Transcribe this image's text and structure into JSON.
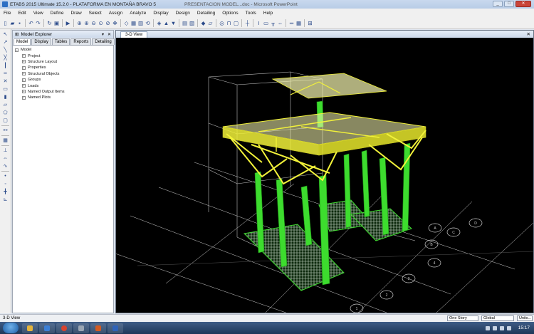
{
  "window": {
    "title": "ETABS 2015 Ultimate 15.2.0 - PLATAFORMA EN MONTAÑA BRAVO 5",
    "second_title": "PRESENTACION MODEL...doc - Microsoft PowerPoint"
  },
  "menu": [
    "File",
    "Edit",
    "View",
    "Define",
    "Draw",
    "Select",
    "Assign",
    "Analyze",
    "Display",
    "Design",
    "Detailing",
    "Options",
    "Tools",
    "Help"
  ],
  "toolbar_icons": [
    "new-icon",
    "open-icon",
    "save-icon",
    "sep",
    "undo-icon",
    "redo-icon",
    "sep",
    "refresh-icon",
    "lock-icon",
    "sep",
    "run-icon",
    "sep",
    "zoom-window-icon",
    "zoom-in-icon",
    "zoom-out-icon",
    "zoom-fit-icon",
    "zoom-prev-icon",
    "pan-icon",
    "sep",
    "3d-view-icon",
    "plan-view-icon",
    "elevation-view-icon",
    "rotate-icon",
    "sep",
    "perspective-icon",
    "up-icon",
    "down-icon",
    "sep",
    "object-shrink-icon",
    "set-display-icon",
    "sep",
    "fill-icon",
    "extrude-icon",
    "sep",
    "object-icon",
    "frame-icon",
    "shell-icon",
    "sep",
    "reference-line-icon",
    "sep",
    "text-icon",
    "box-icon",
    "section-icon",
    "dim-icon",
    "sep",
    "line-style-icon",
    "grid-icon",
    "sep",
    "split-icon"
  ],
  "left_tools": [
    "pointer-icon",
    "reshape-icon",
    "line-icon",
    "brace-icon",
    "column-icon",
    "beam-icon",
    "cross-brace-icon",
    "rect-area-icon",
    "wall-icon",
    "quad-icon",
    "poly-icon",
    "opening-icon",
    "sep",
    "link-icon",
    "sep",
    "grid-area-icon",
    "sep",
    "support-icon",
    "dimension-icon",
    "tendon-icon",
    "sep",
    "snap-point-icon",
    "snap-mid-icon",
    "snap-intersection-icon",
    "snap-perp-icon"
  ],
  "explorer": {
    "title": "Model Explorer",
    "tabs": [
      "Model",
      "Display",
      "Tables",
      "Reports",
      "Detailing"
    ],
    "active_tab": "Model",
    "tree_root": "Model",
    "tree_items": [
      "Project",
      "Structure Layout",
      "Properties",
      "Structural Objects",
      "Groups",
      "Loads",
      "Named Output Items",
      "Named Plots"
    ]
  },
  "viewport": {
    "tab_label": "3-D View",
    "colors": {
      "background": "#000000",
      "columns": "#3ddc2e",
      "beams": "#f2f23a",
      "grid": "#d8d8d8",
      "slab": "#f8f8b0"
    },
    "grid_bubbles": [
      "1",
      "2",
      "3",
      "4",
      "A",
      "B",
      "C",
      "D"
    ]
  },
  "status": {
    "view_label": "3-D View",
    "story": "One Story",
    "coord": "Global",
    "units": "Units..."
  },
  "taskbar": {
    "clock": "15:17"
  }
}
